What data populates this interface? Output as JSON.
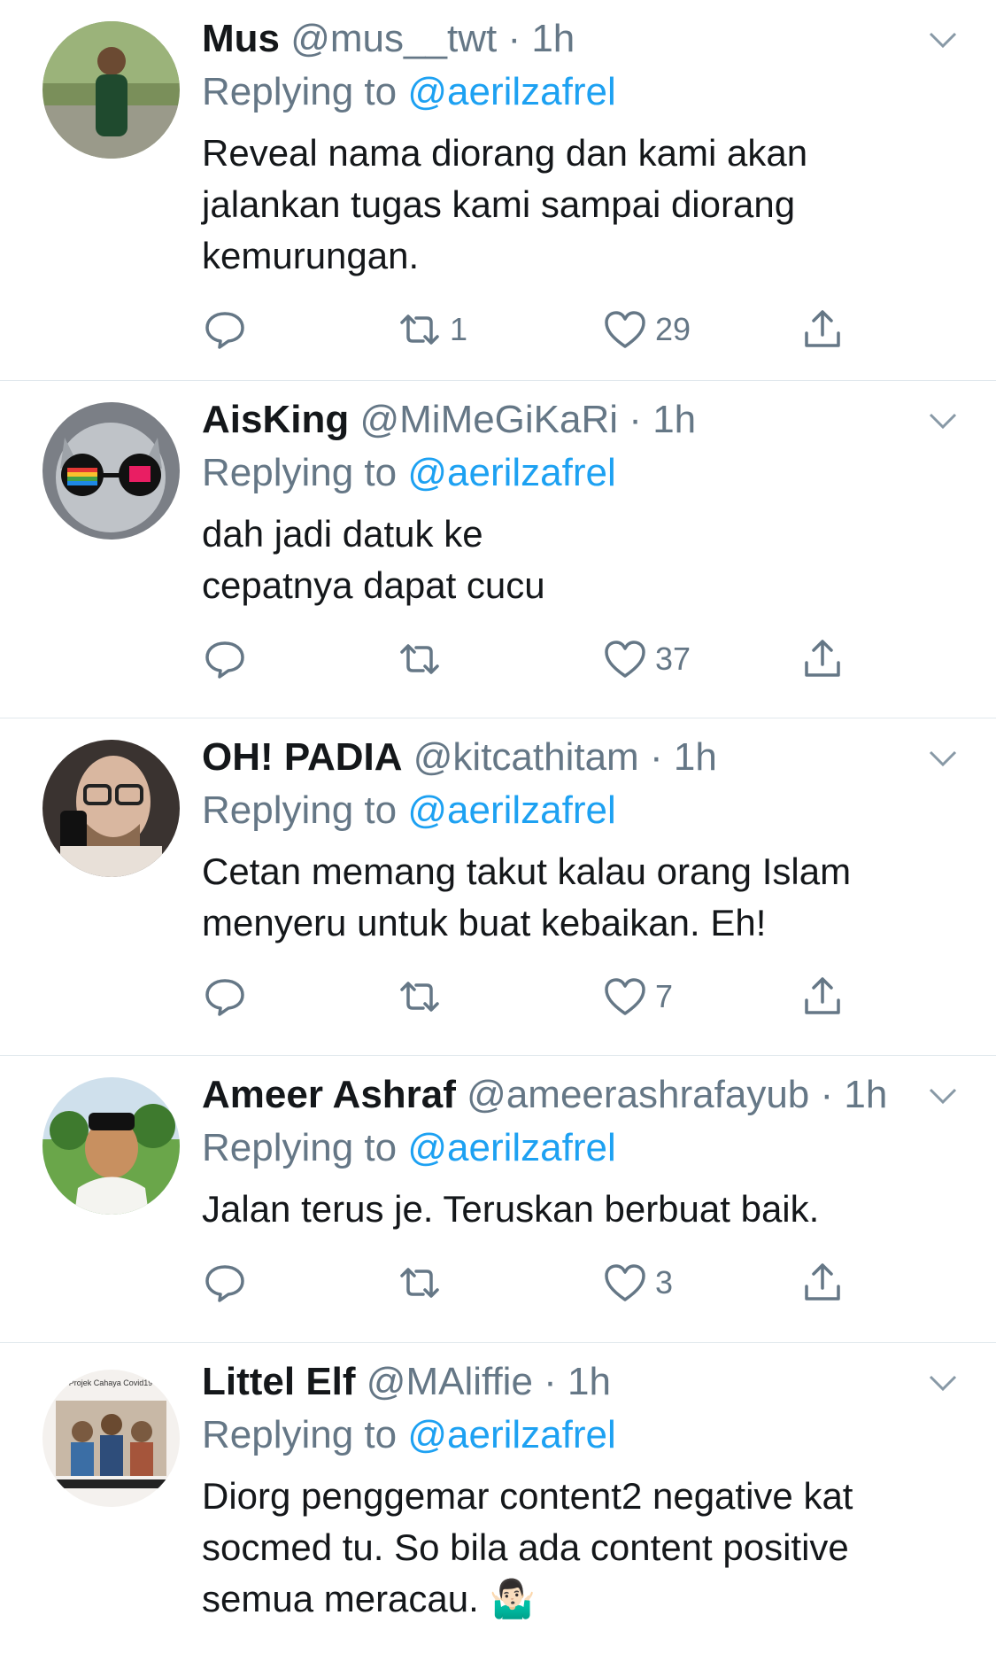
{
  "replies": [
    {
      "name": "Mus",
      "handle": "@mus__twt",
      "time": "1h",
      "replying_prefix": "Replying to ",
      "replying_to": "@aerilzafrel",
      "text_lines": [
        "Reveal nama diorang dan kami akan",
        "jalankan tugas kami sampai diorang",
        "kemurungan."
      ],
      "retweets": "1",
      "likes": "29"
    },
    {
      "name": "AisKing",
      "handle": "@MiMeGiKaRi",
      "time": "1h",
      "replying_prefix": "Replying to ",
      "replying_to": "@aerilzafrel",
      "text_lines": [
        "dah jadi datuk ke",
        "cepatnya dapat cucu"
      ],
      "retweets": "",
      "likes": "37"
    },
    {
      "name": "OH! PADIA",
      "handle": "@kitcathitam",
      "time": "1h",
      "replying_prefix": "Replying to ",
      "replying_to": "@aerilzafrel",
      "text_lines": [
        "Cetan memang takut kalau orang Islam",
        "menyeru untuk buat kebaikan. Eh!"
      ],
      "retweets": "",
      "likes": "7"
    },
    {
      "name": "Ameer Ashraf",
      "handle": "@ameerashrafayub",
      "time": "1h",
      "replying_prefix": "Replying to ",
      "replying_to": "@aerilzafrel",
      "text_lines": [
        "Jalan terus je. Teruskan berbuat baik."
      ],
      "retweets": "",
      "likes": "3"
    },
    {
      "name": "Littel Elf",
      "handle": "@MAliffie",
      "time": "1h",
      "replying_prefix": "Replying to ",
      "replying_to": "@aerilzafrel",
      "text_lines": [
        "Diorg penggemar content2 negative kat",
        "socmed tu. So bila ada content positive",
        "semua meracau. 🤷🏻‍♂️"
      ],
      "retweets": "",
      "likes": ""
    }
  ],
  "avatar_5_text": "Projek Cahaya Covid19",
  "colors": {
    "accent": "#1da1f2",
    "secondary_text": "#657786",
    "divider": "#e1e8ed"
  },
  "icons": [
    "reply-icon",
    "retweet-icon",
    "like-icon",
    "share-icon",
    "chevron-down-icon"
  ]
}
